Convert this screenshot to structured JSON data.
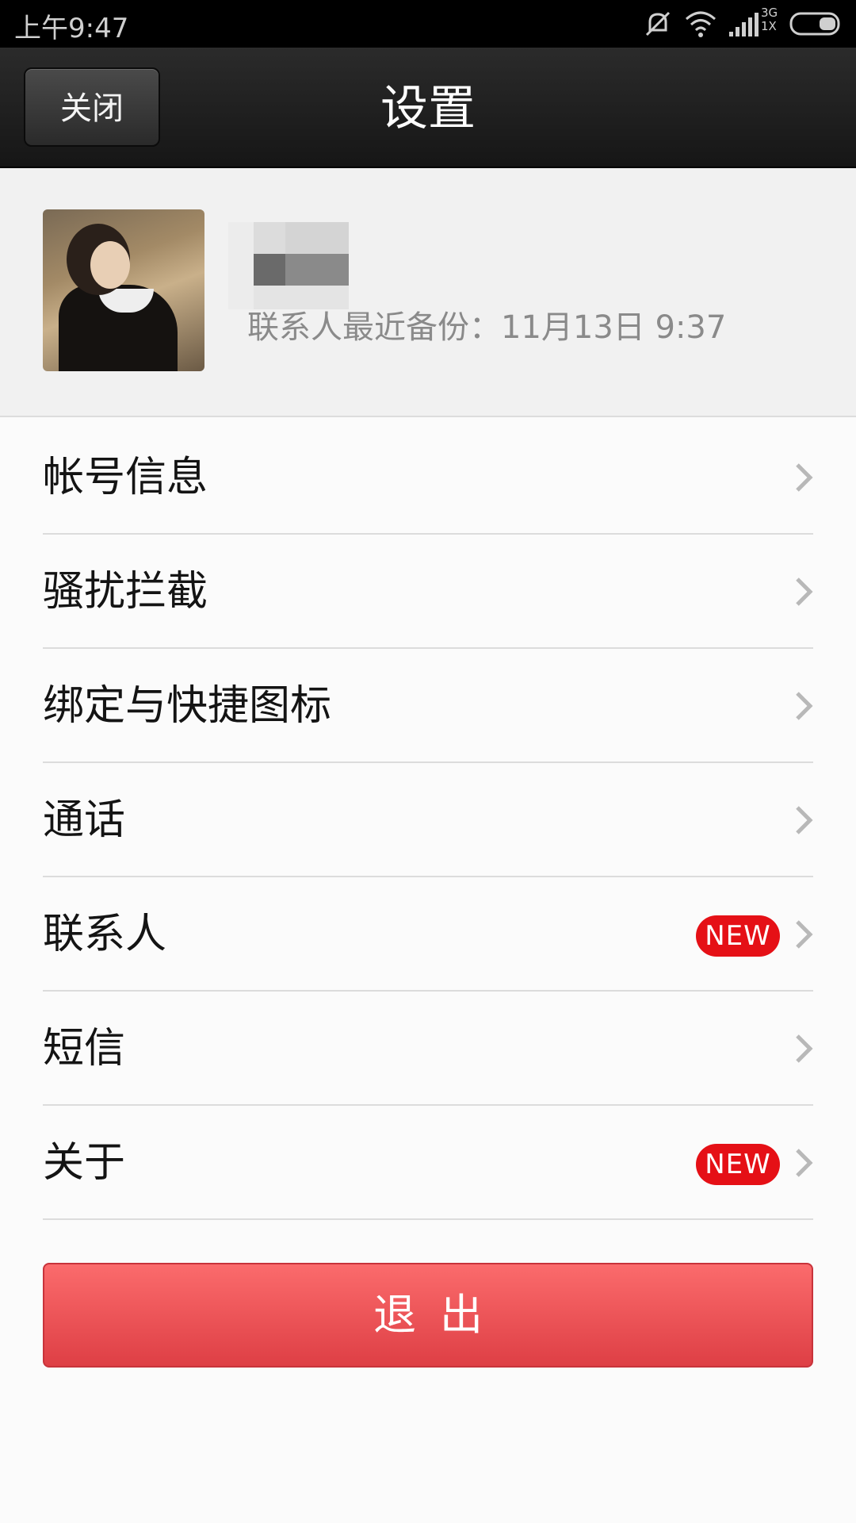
{
  "status_bar": {
    "time": "上午9:47",
    "network_label_top": "3G",
    "network_label_bottom": "1X",
    "icons": [
      "mute-icon",
      "wifi-icon",
      "signal-icon",
      "battery-icon"
    ]
  },
  "title_bar": {
    "close_label": "关闭",
    "title": "设置"
  },
  "profile": {
    "backup_text": "联系人最近备份：11月13日 9:37"
  },
  "menu": {
    "items": [
      {
        "label": "帐号信息",
        "badge": ""
      },
      {
        "label": "骚扰拦截",
        "badge": ""
      },
      {
        "label": "绑定与快捷图标",
        "badge": ""
      },
      {
        "label": "通话",
        "badge": ""
      },
      {
        "label": "联系人",
        "badge": "NEW"
      },
      {
        "label": "短信",
        "badge": ""
      },
      {
        "label": "关于",
        "badge": "NEW"
      }
    ]
  },
  "logout_label": "退出",
  "colors": {
    "badge": "#e51016",
    "logout_top": "#fb6b6c",
    "logout_bottom": "#de3f45",
    "title_bar": "#1f1f1f"
  }
}
